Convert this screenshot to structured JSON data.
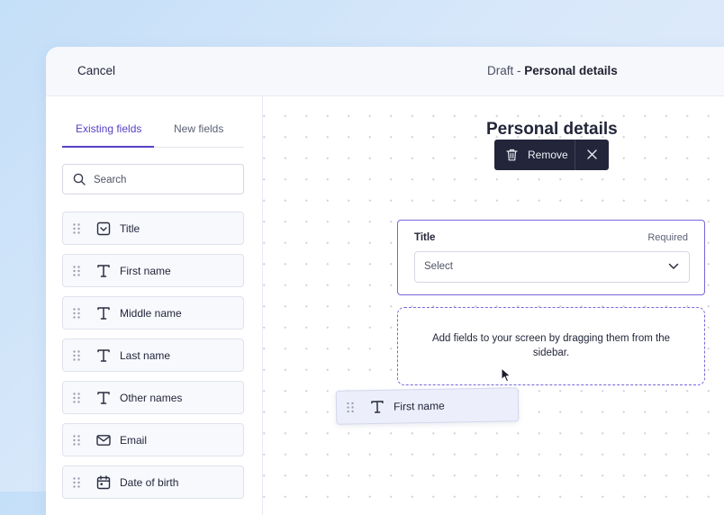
{
  "header": {
    "cancel_label": "Cancel",
    "draft_prefix": "Draft",
    "draft_separator": " - ",
    "screen_name": "Personal details"
  },
  "sidebar": {
    "tabs": [
      {
        "label": "Existing fields",
        "active": true
      },
      {
        "label": "New fields",
        "active": false
      }
    ],
    "search": {
      "placeholder": "Search",
      "value": ""
    },
    "fields": [
      {
        "label": "Title",
        "icon": "dropdown-icon"
      },
      {
        "label": "First name",
        "icon": "text-icon"
      },
      {
        "label": "Middle name",
        "icon": "text-icon"
      },
      {
        "label": "Last name",
        "icon": "text-icon"
      },
      {
        "label": "Other names",
        "icon": "text-icon"
      },
      {
        "label": "Email",
        "icon": "mail-icon"
      },
      {
        "label": "Date of birth",
        "icon": "calendar-icon"
      }
    ]
  },
  "canvas": {
    "screen_title": "Personal details",
    "toolbar": {
      "remove_label": "Remove"
    },
    "title_field": {
      "label": "Title",
      "required_label": "Required",
      "select_placeholder": "Select"
    },
    "dropzone_text": "Add fields to your screen by dragging them from the sidebar.",
    "dragging_field": {
      "label": "First name",
      "icon": "text-icon"
    }
  },
  "colors": {
    "accent": "#5840c8",
    "card_border": "#7767d8",
    "toolbar_bg": "#23253a",
    "background": "#d3e6fa"
  }
}
